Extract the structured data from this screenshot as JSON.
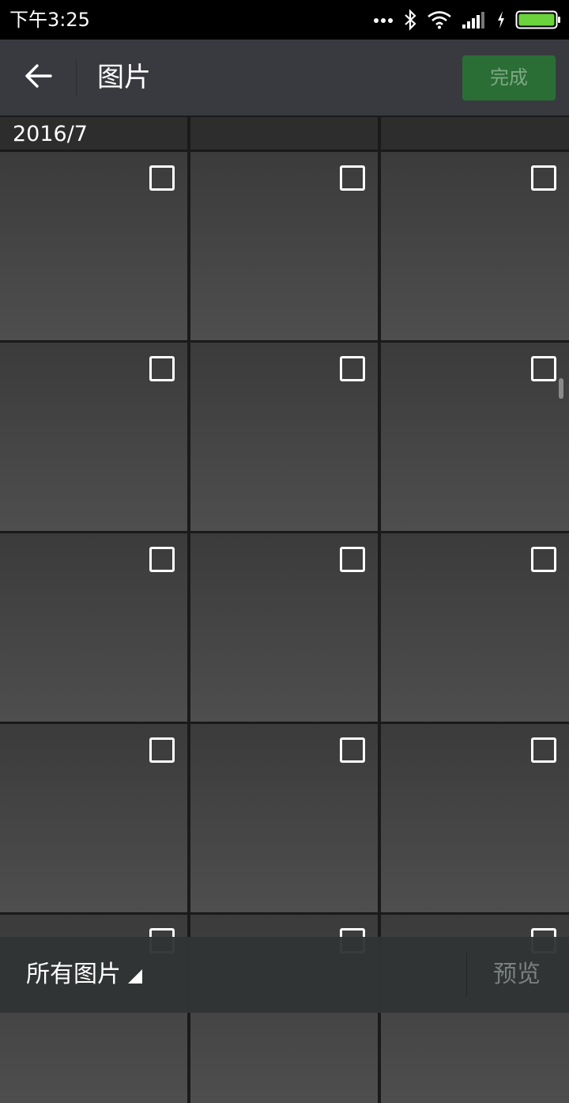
{
  "status_bar": {
    "time": "下午3:25",
    "icons": [
      "more-dots-icon",
      "bluetooth-icon",
      "wifi-icon",
      "signal-icon",
      "charging-icon",
      "battery-icon"
    ]
  },
  "header": {
    "back_icon": "arrow-left-icon",
    "title": "图片",
    "done_label": "完成"
  },
  "grid": {
    "date_label": "2016/7",
    "rows": 5,
    "columns": 3,
    "checkbox_icon": "checkbox-empty-icon"
  },
  "bottom_bar": {
    "album_label": "所有图片",
    "album_caret_icon": "caret-corner-icon",
    "preview_label": "预览"
  },
  "colors": {
    "header_bg": "#393a3f",
    "done_bg": "#2a6e35",
    "done_text": "#7fa886",
    "tile_top": "#3b3b3b",
    "tile_bottom": "#4e4e4e",
    "battery": "#6bd33c"
  }
}
